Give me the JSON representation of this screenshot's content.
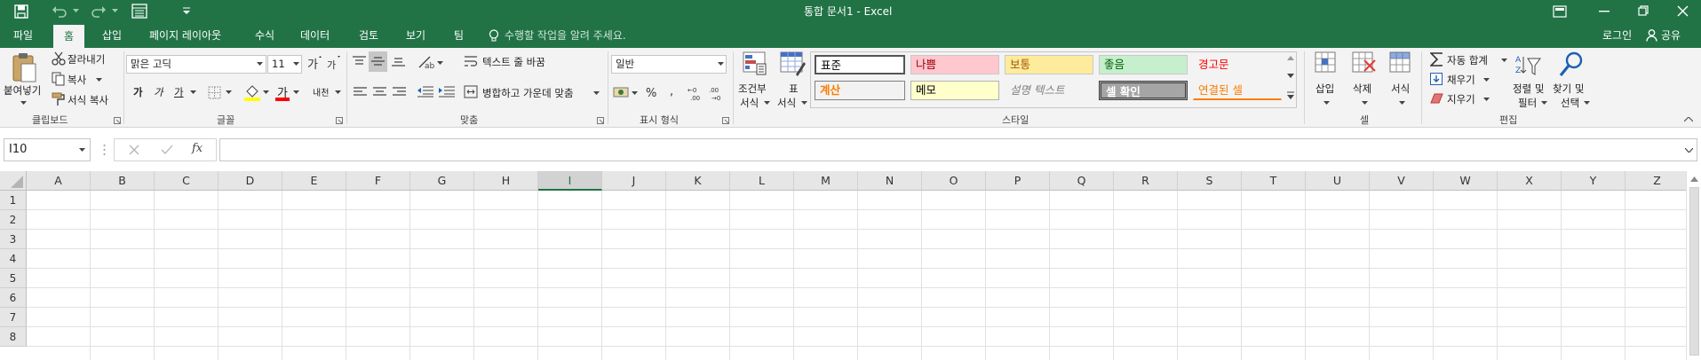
{
  "window": {
    "title": "통합 문서1 - Excel"
  },
  "tabs": [
    "파일",
    "홈",
    "삽입",
    "페이지 레이아웃",
    "수식",
    "데이터",
    "검토",
    "보기",
    "팀"
  ],
  "active_tab": "홈",
  "tell_me_placeholder": "수행할 작업을 알려 주세요.",
  "account": {
    "signin": "로그인",
    "share": "공유"
  },
  "clipboard": {
    "paste": "붙여넣기",
    "cut": "잘라내기",
    "copy": "복사",
    "format_painter": "서식 복사",
    "label": "클립보드"
  },
  "font": {
    "name": "맑은 고딕",
    "size": "11",
    "bold": "가",
    "italic": "가",
    "underline": "가",
    "phonetic": "내천",
    "font_color_glyph": "가",
    "label": "글꼴"
  },
  "alignment": {
    "wrap_text": "텍스트 줄 바꿈",
    "merge_center": "병합하고 가운데 맞춤",
    "label": "맞춤"
  },
  "number": {
    "format": "일반",
    "label": "표시 형식"
  },
  "styles": {
    "conditional": "조건부\n서식",
    "conditional_l1": "조건부",
    "conditional_l2": "서식",
    "table_l1": "표",
    "table_l2": "서식",
    "cells": [
      {
        "label": "표준",
        "bg": "#ffffff",
        "fg": "#000000"
      },
      {
        "label": "나쁨",
        "bg": "#ffc7ce",
        "fg": "#9c0006"
      },
      {
        "label": "보통",
        "bg": "#ffeb9c",
        "fg": "#9c5700"
      },
      {
        "label": "좋음",
        "bg": "#c6efce",
        "fg": "#006100"
      },
      {
        "label": "경고문",
        "bg": "#f3f3f3",
        "fg": "#ff0000"
      },
      {
        "label": "계산",
        "bg": "#f2f2f2",
        "fg": "#fa7d00"
      },
      {
        "label": "메모",
        "bg": "#ffffcc",
        "fg": "#000000"
      },
      {
        "label": "설명 텍스트",
        "bg": "#f3f3f3",
        "fg": "#7f7f7f"
      },
      {
        "label": "셀 확인",
        "bg": "#a5a5a5",
        "fg": "#ffffff"
      },
      {
        "label": "연결된 셀",
        "bg": "#f3f3f3",
        "fg": "#fa7d00"
      }
    ],
    "label": "스타일"
  },
  "cells_group": {
    "insert": "삽입",
    "delete": "삭제",
    "format": "서식",
    "label": "셀"
  },
  "editing": {
    "autosum": "자동 합계",
    "fill": "채우기",
    "clear": "지우기",
    "sort_l1": "정렬 및",
    "sort_l2": "필터",
    "find_l1": "찾기 및",
    "find_l2": "선택",
    "label": "편집"
  },
  "formula_bar": {
    "name_box": "I10",
    "fx": "fx",
    "value": ""
  },
  "columns": [
    "A",
    "B",
    "C",
    "D",
    "E",
    "F",
    "G",
    "H",
    "I",
    "J",
    "K",
    "L",
    "M",
    "N",
    "O",
    "P",
    "Q",
    "R",
    "S",
    "T",
    "U",
    "V",
    "W",
    "X",
    "Y",
    "Z"
  ],
  "rows": [
    "1",
    "2",
    "3",
    "4",
    "5",
    "6",
    "7",
    "8"
  ],
  "colors": {
    "brand": "#217346",
    "selected_header": "#d2d2d2"
  }
}
